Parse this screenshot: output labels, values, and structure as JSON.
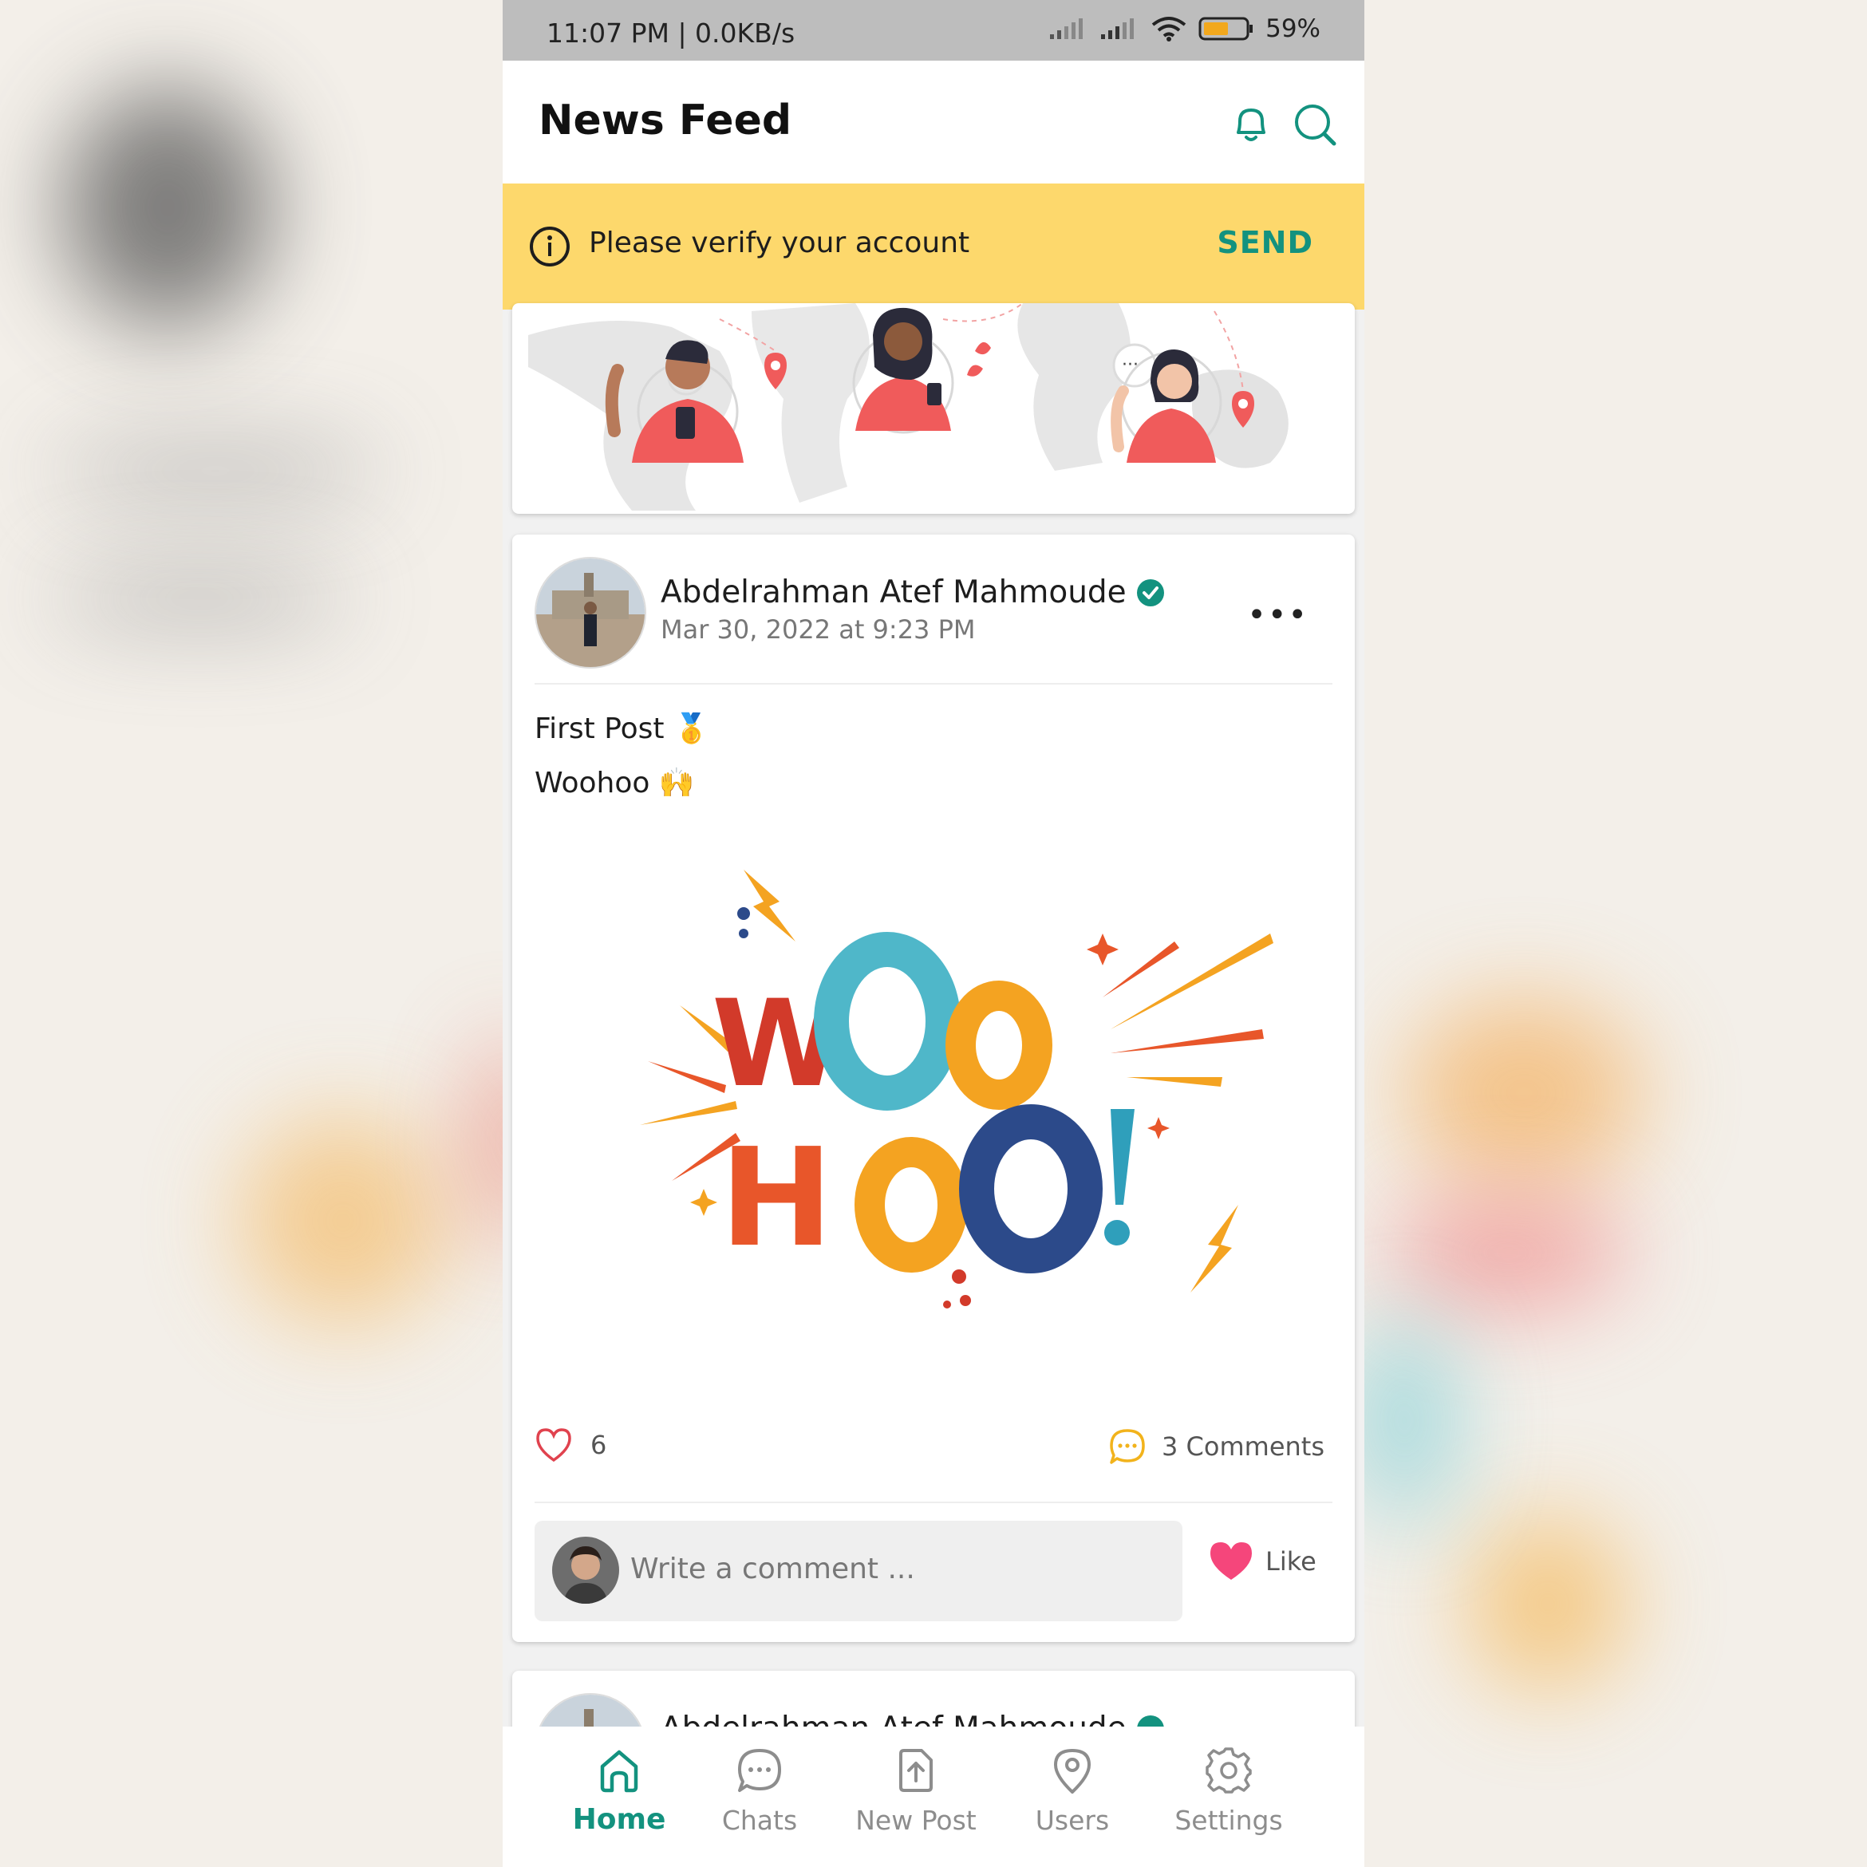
{
  "status_bar": {
    "time": "11:07 PM | 0.0KB/s",
    "battery": "59%"
  },
  "header": {
    "title": "News Feed",
    "icons": [
      "bell-icon",
      "search-icon"
    ]
  },
  "verify_banner": {
    "message": "Please verify your account",
    "action": "SEND"
  },
  "post": {
    "author": "Abdelrahman Atef Mahmoude",
    "verified": true,
    "timestamp": "Mar 30, 2022 at 9:23 PM",
    "lines": [
      "First Post 🥇",
      "Woohoo 🙌"
    ],
    "likes": "6",
    "comments": "3 Comments",
    "comment_placeholder": "Write a comment ...",
    "like_label": "Like"
  },
  "next_post": {
    "author": "Abdelrahman Atef Mahmoude"
  },
  "nav": [
    {
      "label": "Home",
      "icon": "home-icon",
      "active": true
    },
    {
      "label": "Chats",
      "icon": "chat-icon",
      "active": false
    },
    {
      "label": "New Post",
      "icon": "upload-icon",
      "active": false
    },
    {
      "label": "Users",
      "icon": "location-icon",
      "active": false
    },
    {
      "label": "Settings",
      "icon": "gear-icon",
      "active": false
    }
  ],
  "colors": {
    "accent": "#13927f",
    "banner": "#fdd86c",
    "like": "#f5467b"
  }
}
